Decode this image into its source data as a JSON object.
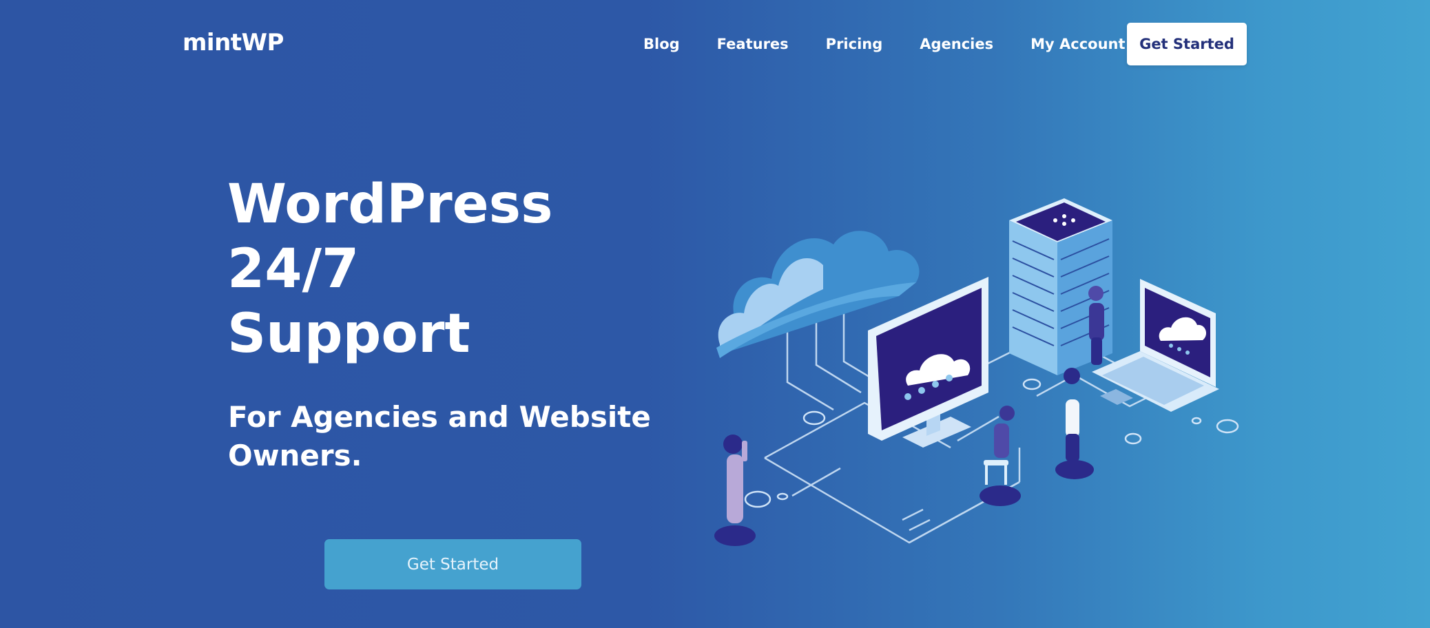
{
  "brand": {
    "name": "mintWP"
  },
  "nav": {
    "links": [
      {
        "label": "Blog"
      },
      {
        "label": "Features"
      },
      {
        "label": "Pricing"
      },
      {
        "label": "Agencies"
      },
      {
        "label": "My Account"
      }
    ],
    "cta_label": "Get Started"
  },
  "hero": {
    "title_line1": "WordPress",
    "title_line2": "24/7 Support",
    "subtitle_line1": "For Agencies and Website",
    "subtitle_line2": "Owners.",
    "cta_label": "Get Started"
  },
  "illustration": {
    "icons": [
      "cloud-icon",
      "server-rack-icon",
      "monitor-icon",
      "laptop-icon",
      "person-icon"
    ]
  },
  "colors": {
    "background_start": "#2d55a4",
    "background_end": "#42a3d1",
    "nav_cta_bg": "#ffffff",
    "nav_cta_text": "#23307a",
    "hero_cta_bg": "#45a2cf",
    "illustration_dark": "#2b1f7e",
    "illustration_light": "#5fb0dd"
  }
}
